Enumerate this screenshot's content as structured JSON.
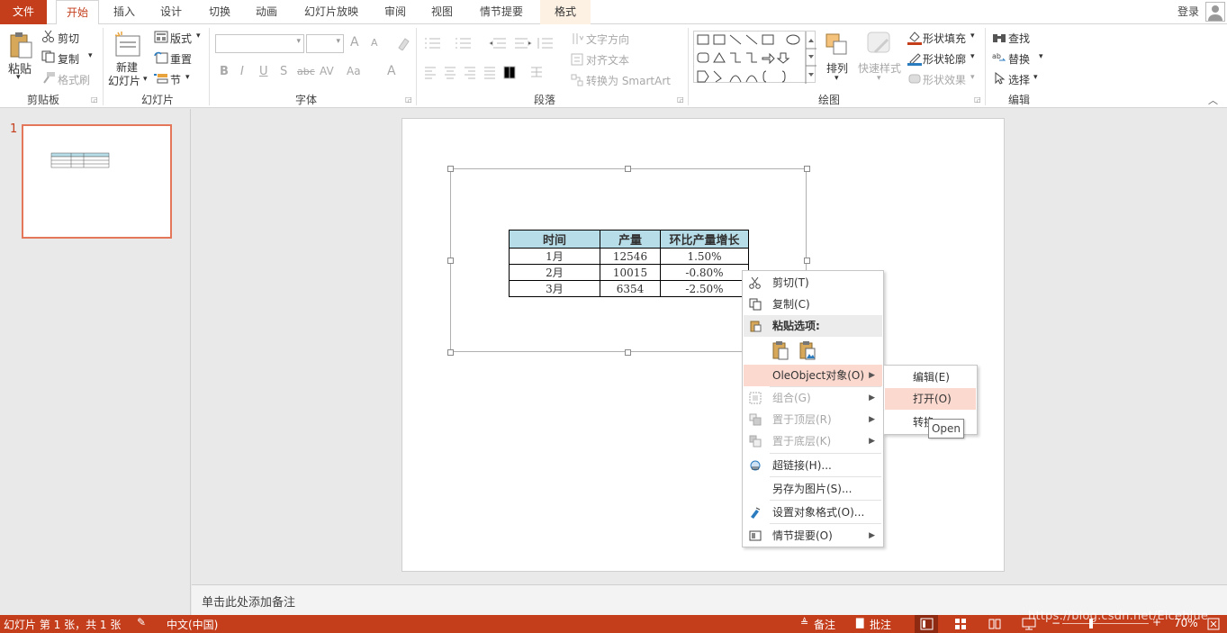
{
  "tabs": {
    "file": "文件",
    "home": "开始",
    "insert": "插入",
    "design": "设计",
    "transitions": "切换",
    "animations": "动画",
    "slideshow": "幻灯片放映",
    "review": "审阅",
    "view": "视图",
    "storyboard": "情节提要",
    "format": "格式",
    "login": "登录"
  },
  "ribbon": {
    "clipboard": {
      "paste": "粘贴",
      "cut": "剪切",
      "copy": "复制",
      "format_painter": "格式刷",
      "label": "剪贴板"
    },
    "slides": {
      "new_slide_1": "新建",
      "new_slide_2": "幻灯片",
      "layout": "版式",
      "reset": "重置",
      "section": "节",
      "label": "幻灯片"
    },
    "font": {
      "label": "字体",
      "bold": "B",
      "italic": "I",
      "underline": "U",
      "shadow": "S",
      "strike": "abc",
      "spacing": "AV",
      "case": "Aa",
      "color": "A",
      "grow": "A",
      "shrink": "A"
    },
    "paragraph": {
      "text_direction": "文字方向",
      "align_text": "对齐文本",
      "smartart": "转换为 SmartArt",
      "label": "段落"
    },
    "drawing": {
      "arrange": "排列",
      "quick_styles": "快速样式",
      "shape_fill": "形状填充",
      "shape_outline": "形状轮廓",
      "shape_effects": "形状效果",
      "label": "绘图"
    },
    "editing": {
      "find": "查找",
      "replace": "替换",
      "select": "选择",
      "label": "编辑"
    }
  },
  "thumbnail": {
    "number": "1"
  },
  "table": {
    "headers": [
      "时间",
      "产量",
      "环比产量增长"
    ],
    "rows": [
      [
        "1月",
        "12546",
        "1.50%"
      ],
      [
        "2月",
        "10015",
        "-0.80%"
      ],
      [
        "3月",
        "6354",
        "-2.50%"
      ]
    ]
  },
  "context_menu": {
    "cut": "剪切(T)",
    "copy": "复制(C)",
    "paste_options": "粘贴选项:",
    "oleobject": "OleObject对象(O)",
    "group": "组合(G)",
    "bring_front": "置于顶层(R)",
    "send_back": "置于底层(K)",
    "hyperlink": "超链接(H)...",
    "save_as_picture": "另存为图片(S)...",
    "format_object": "设置对象格式(O)...",
    "storyboard": "情节提要(O)"
  },
  "submenu": {
    "edit": "编辑(E)",
    "open": "打开(O)",
    "convert": "转换"
  },
  "tooltip": "Open",
  "notes_placeholder": "单击此处添加备注",
  "status": {
    "slide_info": "幻灯片 第 1 张，共 1 张",
    "language": "中文(中国)",
    "notes": "备注",
    "comments": "批注",
    "zoom": "70%",
    "watermark": "https://blog.csdn.net/Eiceblue"
  },
  "colors": {
    "accent": "#c43e1c",
    "selection": "#e4775a",
    "header_fill": "#b7dde8",
    "menu_highlight": "#fbd9cf"
  }
}
